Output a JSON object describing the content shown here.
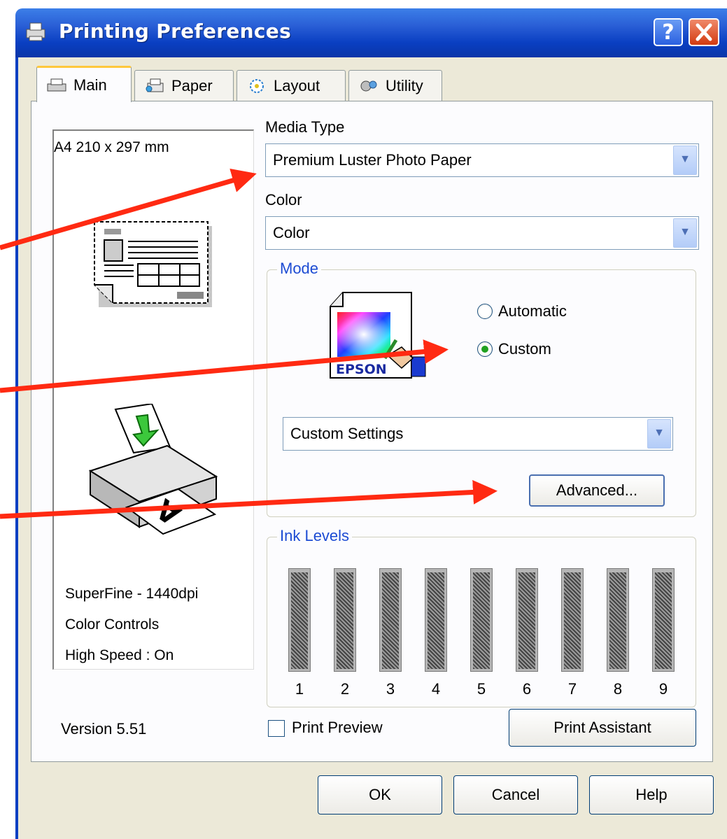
{
  "window": {
    "title": "Printing Preferences"
  },
  "tabs": [
    {
      "label": "Main",
      "active": true
    },
    {
      "label": "Paper",
      "active": false
    },
    {
      "label": "Layout",
      "active": false
    },
    {
      "label": "Utility",
      "active": false
    }
  ],
  "preview": {
    "paper_size": "A4 210 x 297 mm",
    "lines": [
      "SuperFine - 1440dpi",
      "Color Controls",
      "High Speed : On"
    ]
  },
  "media_type": {
    "label": "Media Type",
    "value": "Premium Luster Photo Paper"
  },
  "color": {
    "label": "Color",
    "value": "Color"
  },
  "mode": {
    "title": "Mode",
    "options": [
      {
        "label": "Automatic",
        "checked": false
      },
      {
        "label": "Custom",
        "checked": true
      }
    ],
    "settings_value": "Custom Settings",
    "advanced_label": "Advanced..."
  },
  "ink_levels": {
    "title": "Ink Levels",
    "cartridges": [
      "1",
      "2",
      "3",
      "4",
      "5",
      "6",
      "7",
      "8",
      "9"
    ]
  },
  "footer": {
    "version": "Version 5.51",
    "print_preview_label": "Print Preview",
    "print_preview_checked": false,
    "print_assistant_label": "Print Assistant"
  },
  "buttons": {
    "ok": "OK",
    "cancel": "Cancel",
    "help": "Help"
  },
  "annotation_color": "#ff2a12"
}
